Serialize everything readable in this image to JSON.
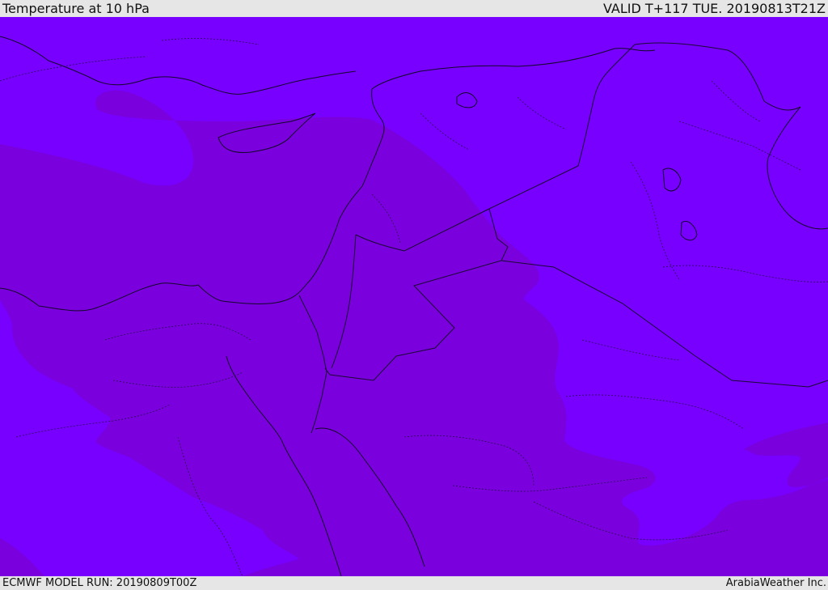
{
  "header": {
    "title": "Temperature at 10 hPa",
    "valid": "VALID T+117 TUE. 20190813T21Z"
  },
  "footer": {
    "model_run": "ECMWF MODEL RUN: 20190809T00Z",
    "brand": "ArabiaWeather Inc."
  },
  "map": {
    "colors": {
      "band_light": "#7700ff",
      "band_dark": "#7a00dd",
      "border": "#1a0a33"
    }
  }
}
